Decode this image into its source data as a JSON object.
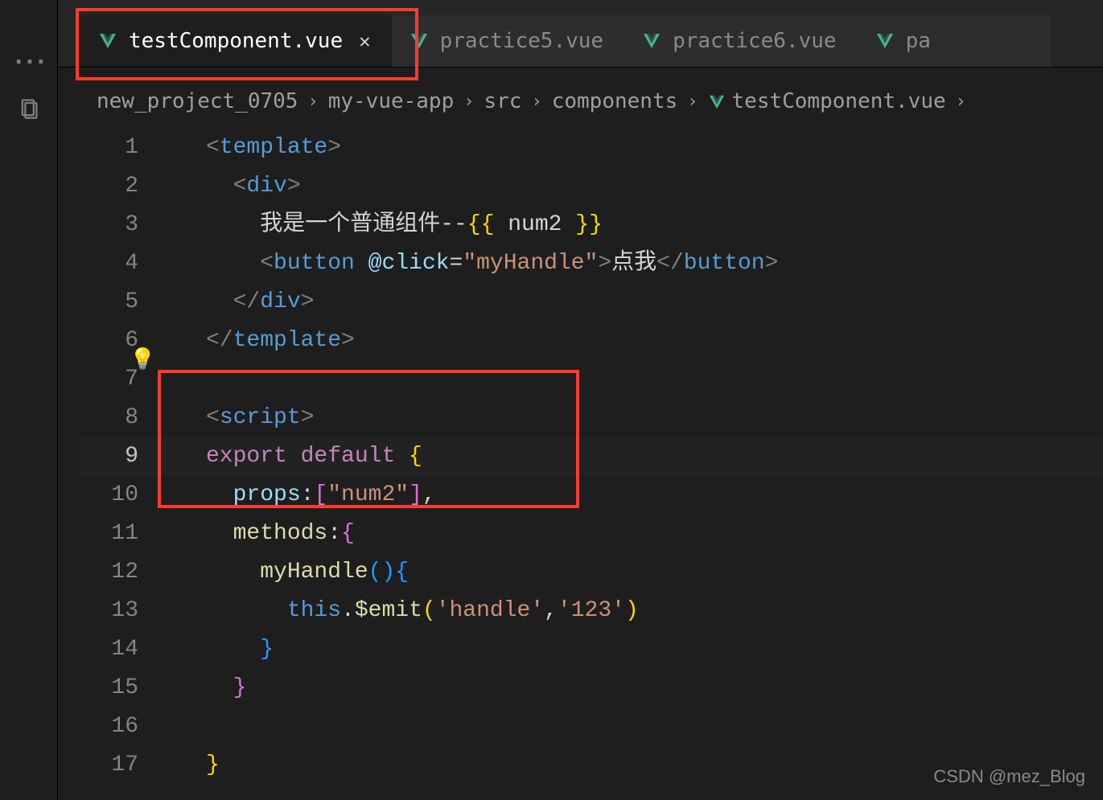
{
  "tabs": [
    {
      "label": "testComponent.vue",
      "active": true,
      "has_close": true
    },
    {
      "label": "practice5.vue",
      "active": false,
      "has_close": false
    },
    {
      "label": "practice6.vue",
      "active": false,
      "has_close": false
    },
    {
      "label": "pa",
      "active": false,
      "has_close": false
    }
  ],
  "breadcrumb": {
    "seg0": "new_project_0705",
    "seg1": "my-vue-app",
    "seg2": "src",
    "seg3": "components",
    "seg4": "testComponent.vue"
  },
  "code": {
    "lines": [
      {
        "n": "1",
        "tokens": [
          [
            "c-bracket",
            "<"
          ],
          [
            "c-tag",
            "template"
          ],
          [
            "c-bracket",
            ">"
          ]
        ]
      },
      {
        "n": "2",
        "tokens": [
          [
            "c-text",
            "  "
          ],
          [
            "c-bracket",
            "<"
          ],
          [
            "c-tag",
            "div"
          ],
          [
            "c-bracket",
            ">"
          ]
        ]
      },
      {
        "n": "3",
        "tokens": [
          [
            "c-text",
            "    我是一个普通组件--"
          ],
          [
            "c-brace",
            "{{ "
          ],
          [
            "c-text",
            "num2"
          ],
          [
            "c-brace",
            " }}"
          ]
        ]
      },
      {
        "n": "4",
        "tokens": [
          [
            "c-text",
            "    "
          ],
          [
            "c-bracket",
            "<"
          ],
          [
            "c-tag",
            "button"
          ],
          [
            "c-text",
            " "
          ],
          [
            "c-attr",
            "@click"
          ],
          [
            "c-punct",
            "="
          ],
          [
            "c-string",
            "\"myHandle\""
          ],
          [
            "c-bracket",
            ">"
          ],
          [
            "c-text",
            "点我"
          ],
          [
            "c-bracket",
            "</"
          ],
          [
            "c-tag",
            "button"
          ],
          [
            "c-bracket",
            ">"
          ]
        ]
      },
      {
        "n": "5",
        "tokens": [
          [
            "c-text",
            "  "
          ],
          [
            "c-bracket",
            "</"
          ],
          [
            "c-tag",
            "div"
          ],
          [
            "c-bracket",
            ">"
          ]
        ]
      },
      {
        "n": "6",
        "tokens": [
          [
            "c-bracket",
            "</"
          ],
          [
            "c-tag",
            "template"
          ],
          [
            "c-bracket",
            ">"
          ]
        ]
      },
      {
        "n": "7",
        "tokens": [
          [
            "c-text",
            ""
          ]
        ]
      },
      {
        "n": "8",
        "tokens": [
          [
            "c-bracket",
            "<"
          ],
          [
            "c-tag",
            "script"
          ],
          [
            "c-bracket",
            ">"
          ]
        ]
      },
      {
        "n": "9",
        "current": true,
        "tokens": [
          [
            "c-key",
            "export "
          ],
          [
            "c-key",
            "default "
          ],
          [
            "c-brace",
            "{"
          ]
        ]
      },
      {
        "n": "10",
        "tokens": [
          [
            "c-text",
            "  "
          ],
          [
            "c-attr",
            "props"
          ],
          [
            "c-punct",
            ":"
          ],
          [
            "c-bracePk",
            "["
          ],
          [
            "c-string",
            "\"num2\""
          ],
          [
            "c-bracePk",
            "]"
          ],
          [
            "c-punct",
            ","
          ]
        ]
      },
      {
        "n": "11",
        "tokens": [
          [
            "c-text",
            "  "
          ],
          [
            "c-func",
            "methods"
          ],
          [
            "c-punct",
            ":"
          ],
          [
            "c-bracePk",
            "{"
          ]
        ]
      },
      {
        "n": "12",
        "tokens": [
          [
            "c-text",
            "    "
          ],
          [
            "c-func",
            "myHandle"
          ],
          [
            "c-braceBl",
            "()"
          ],
          [
            "c-braceBl",
            "{"
          ]
        ]
      },
      {
        "n": "13",
        "tokens": [
          [
            "c-text",
            "      "
          ],
          [
            "c-this",
            "this"
          ],
          [
            "c-punct",
            "."
          ],
          [
            "c-func",
            "$emit"
          ],
          [
            "c-brace",
            "("
          ],
          [
            "c-string",
            "'handle'"
          ],
          [
            "c-punct",
            ","
          ],
          [
            "c-string",
            "'123'"
          ],
          [
            "c-brace",
            ")"
          ]
        ]
      },
      {
        "n": "14",
        "tokens": [
          [
            "c-text",
            "    "
          ],
          [
            "c-braceBl",
            "}"
          ]
        ]
      },
      {
        "n": "15",
        "tokens": [
          [
            "c-text",
            "  "
          ],
          [
            "c-bracePk",
            "}"
          ]
        ]
      },
      {
        "n": "16",
        "tokens": [
          [
            "c-text",
            ""
          ]
        ]
      },
      {
        "n": "17",
        "tokens": [
          [
            "c-brace",
            "}"
          ]
        ]
      }
    ]
  },
  "watermark": "CSDN @mez_Blog"
}
